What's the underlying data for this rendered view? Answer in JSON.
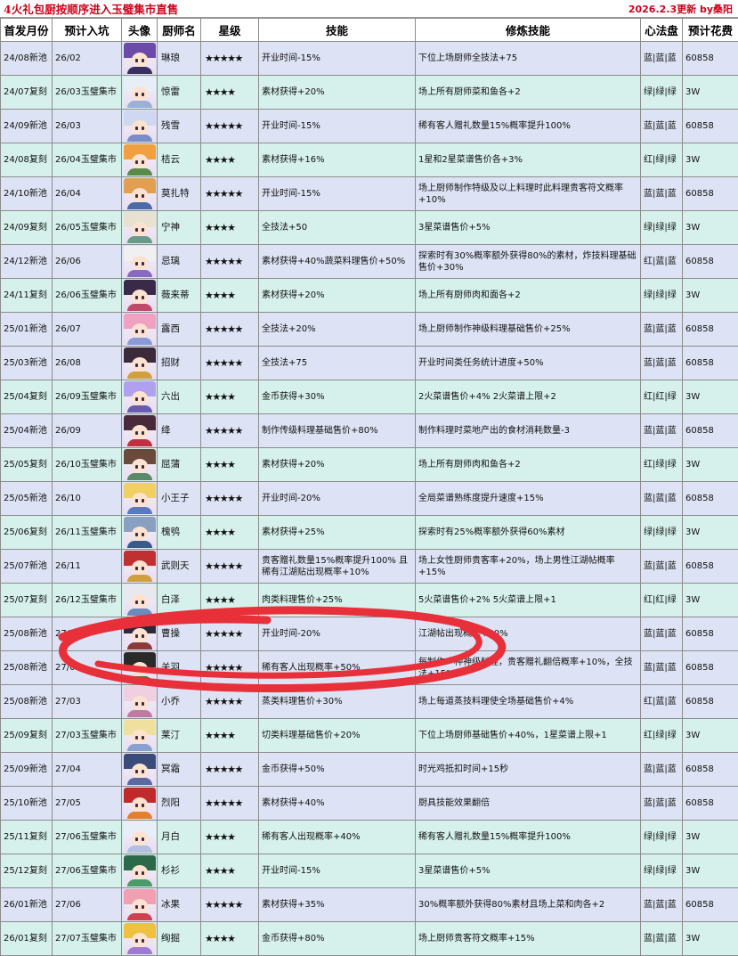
{
  "header": {
    "title": "4火礼包厨按顺序进入玉璧集市直售",
    "update": "2026.2.3更新 by桑阳"
  },
  "columns": [
    "首发月份",
    "预计入坑",
    "头像",
    "厨师名",
    "星级",
    "技能",
    "修炼技能",
    "心法盘",
    "预计花费"
  ],
  "colors": {
    "blue_row": "#dde3f4",
    "green_row": "#d6f1ec",
    "title_red": "#d0021b",
    "annotation_red": "#e8303a"
  },
  "rows": [
    {
      "first": "24/08新池",
      "entry": "26/02",
      "avatar": "avatar-linlang",
      "name": "琳琅",
      "stars": "★★★★★",
      "skill": "开业时间-15%",
      "cultivate": "下位上场厨师全技法+75",
      "heart": "蓝|蓝|蓝",
      "cost": "60858",
      "tint": "blue",
      "hair": "#6b4aa8",
      "cloth": "#3a3060"
    },
    {
      "first": "24/07复刻",
      "entry": "26/03玉璧集市",
      "avatar": "avatar-jinglei",
      "name": "惊雷",
      "stars": "★★★★",
      "skill": "素材获得+20%",
      "cultivate": "场上所有厨师菜和鱼各+2",
      "heart": "绿|绿|绿",
      "cost": "3W",
      "tint": "green",
      "hair": "#e8eef8",
      "cloth": "#9ab0d8"
    },
    {
      "first": "24/09新池",
      "entry": "26/03",
      "avatar": "avatar-canxue",
      "name": "残雪",
      "stars": "★★★★★",
      "skill": "开业时间-15%",
      "cultivate": "稀有客人赠礼数量15%概率提升100%",
      "heart": "蓝|蓝|蓝",
      "cost": "60858",
      "tint": "blue",
      "hair": "#cfd8f0",
      "cloth": "#7b8cc8"
    },
    {
      "first": "24/08复刻",
      "entry": "26/04玉璧集市",
      "avatar": "avatar-jieyun",
      "name": "桔云",
      "stars": "★★★★",
      "skill": "素材获得+16%",
      "cultivate": "1星和2星菜谱售价各+3%",
      "heart": "红|绿|绿",
      "cost": "3W",
      "tint": "green",
      "hair": "#f0a040",
      "cloth": "#5a8a4a"
    },
    {
      "first": "24/10新池",
      "entry": "26/04",
      "avatar": "avatar-mozhate",
      "name": "莫扎特",
      "stars": "★★★★★",
      "skill": "开业时间-15%",
      "cultivate": "场上厨师制作特级及以上料理时此料理贵客符文概率+10%",
      "heart": "蓝|蓝|蓝",
      "cost": "60858",
      "tint": "blue",
      "hair": "#e0a050",
      "cloth": "#4a6aa8"
    },
    {
      "first": "24/09复刻",
      "entry": "26/05玉璧集市",
      "avatar": "avatar-ningshen",
      "name": "宁神",
      "stars": "★★★★",
      "skill": "全技法+50",
      "cultivate": "3星菜谱售价+5%",
      "heart": "绿|绿|绿",
      "cost": "3W",
      "tint": "green",
      "hair": "#e8e0d0",
      "cloth": "#6a9a8a"
    },
    {
      "first": "24/12新池",
      "entry": "26/06",
      "avatar": "avatar-jili",
      "name": "忌璃",
      "stars": "★★★★★",
      "skill": "素材获得+40%蔬菜料理售价+50%",
      "cultivate": "探索时有30%概率额外获得80%的素材，炸技料理基础售价+30%",
      "heart": "红|蓝|蓝",
      "cost": "60858",
      "tint": "blue",
      "hair": "#f0f0f0",
      "cloth": "#8a6ac0"
    },
    {
      "first": "24/11复刻",
      "entry": "26/06玉璧集市",
      "avatar": "avatar-weilaidi",
      "name": "薇来蒂",
      "stars": "★★★★",
      "skill": "素材获得+20%",
      "cultivate": "场上所有厨师肉和面各+2",
      "heart": "绿|绿|绿",
      "cost": "3W",
      "tint": "green",
      "hair": "#3a2a4a",
      "cloth": "#c04a6a"
    },
    {
      "first": "25/01新池",
      "entry": "26/07",
      "avatar": "avatar-luxi",
      "name": "露西",
      "stars": "★★★★★",
      "skill": "全技法+20%",
      "cultivate": "场上厨师制作神级料理基础售价+25%",
      "heart": "蓝|蓝|蓝",
      "cost": "60858",
      "tint": "blue",
      "hair": "#f0a0c0",
      "cloth": "#8a9ad8"
    },
    {
      "first": "25/03新池",
      "entry": "26/08",
      "avatar": "avatar-zhaocai",
      "name": "招财",
      "stars": "★★★★★",
      "skill": "全技法+75",
      "cultivate": "开业时间类任务统计进度+50%",
      "heart": "蓝|蓝|蓝",
      "cost": "60858",
      "tint": "blue",
      "hair": "#3a2a3a",
      "cloth": "#d0a040"
    },
    {
      "first": "25/04复刻",
      "entry": "26/09玉璧集市",
      "avatar": "avatar-liuchu",
      "name": "六出",
      "stars": "★★★★",
      "skill": "金币获得+30%",
      "cultivate": "2火菜谱售价+4% 2火菜谱上限+2",
      "heart": "红|红|绿",
      "cost": "3W",
      "tint": "green",
      "hair": "#b0a0f0",
      "cloth": "#6a5ab0"
    },
    {
      "first": "25/04新池",
      "entry": "26/09",
      "avatar": "avatar-feng",
      "name": "绛",
      "stars": "★★★★★",
      "skill": "制作传级料理基础售价+80%",
      "cultivate": "制作料理时菜地产出的食材消耗数量-3",
      "heart": "蓝|蓝|蓝",
      "cost": "60858",
      "tint": "blue",
      "hair": "#4a2a3a",
      "cloth": "#c03040"
    },
    {
      "first": "25/05复刻",
      "entry": "26/10玉璧集市",
      "avatar": "avatar-qupu",
      "name": "屈蒲",
      "stars": "★★★★",
      "skill": "素材获得+20%",
      "cultivate": "场上所有厨师肉和鱼各+2",
      "heart": "红|绿|绿",
      "cost": "3W",
      "tint": "green",
      "hair": "#6a4a3a",
      "cloth": "#5a8a6a"
    },
    {
      "first": "25/05新池",
      "entry": "26/10",
      "avatar": "avatar-xiaowangzi",
      "name": "小王子",
      "stars": "★★★★★",
      "skill": "开业时间-20%",
      "cultivate": "全局菜谱熟练度提升速度+15%",
      "heart": "蓝|蓝|蓝",
      "cost": "60858",
      "tint": "blue",
      "hair": "#f0d060",
      "cloth": "#5a7ac0"
    },
    {
      "first": "25/06复刻",
      "entry": "26/11玉璧集市",
      "avatar": "avatar-kuige",
      "name": "槐鸮",
      "stars": "★★★★",
      "skill": "素材获得+25%",
      "cultivate": "探索时有25%概率额外获得60%素材",
      "heart": "绿|绿|绿",
      "cost": "3W",
      "tint": "green",
      "hair": "#8aa0c0",
      "cloth": "#3a5a8a"
    },
    {
      "first": "25/07新池",
      "entry": "26/11",
      "avatar": "avatar-wuzetian",
      "name": "武则天",
      "stars": "★★★★★",
      "skill": "贵客赠礼数量15%概率提升100% 且稀有江湖贴出现概率+10%",
      "cultivate": "场上女性厨师贵客率+20%，场上男性江湖帖概率+15%",
      "heart": "蓝|蓝|蓝",
      "cost": "60858",
      "tint": "blue",
      "hair": "#c03030",
      "cloth": "#d0a040"
    },
    {
      "first": "25/07复刻",
      "entry": "26/12玉璧集市",
      "avatar": "avatar-baize",
      "name": "白泽",
      "stars": "★★★★",
      "skill": "肉类料理售价+25%",
      "cultivate": "5火菜谱售价+2% 5火菜谱上限+1",
      "heart": "红|红|绿",
      "cost": "3W",
      "tint": "green",
      "hair": "#e8e8f0",
      "cloth": "#6a8ac0"
    },
    {
      "first": "25/08新池",
      "entry": "27/01",
      "avatar": "avatar-caocao",
      "name": "曹操",
      "stars": "★★★★★",
      "skill": "开业时间-20%",
      "cultivate": "江湖帖出现概率+40%",
      "heart": "蓝|蓝|蓝",
      "cost": "60858",
      "tint": "blue",
      "hair": "#2a2a3a",
      "cloth": "#8a3a3a"
    },
    {
      "first": "25/08新池",
      "entry": "27/02",
      "avatar": "avatar-guanyu",
      "name": "关羽",
      "stars": "★★★★★",
      "skill": "稀有客人出现概率+50%",
      "cultivate": "每制作一种神级料理，贵客赠礼翻倍概率+10%，全技法+15%",
      "heart": "蓝|蓝|蓝",
      "cost": "60858",
      "tint": "blue",
      "hair": "#2a2a2a",
      "cloth": "#3a7a3a"
    },
    {
      "first": "25/08新池",
      "entry": "27/03",
      "avatar": "avatar-xiaoqiao",
      "name": "小乔",
      "stars": "★★★★★",
      "skill": "蒸类料理售价+30%",
      "cultivate": "场上每道蒸技料理使全场基础售价+4%",
      "heart": "红|蓝|蓝",
      "cost": "60858",
      "tint": "blue",
      "hair": "#f0d0e0",
      "cloth": "#c07aa0"
    },
    {
      "first": "25/09复刻",
      "entry": "27/03玉璧集市",
      "avatar": "avatar-moting",
      "name": "莱汀",
      "stars": "★★★★",
      "skill": "切类料理基础售价+20%",
      "cultivate": "下位上场厨师基础售价+40%，1星菜谱上限+1",
      "heart": "红|绿|绿",
      "cost": "3W",
      "tint": "green",
      "hair": "#f0e0a0",
      "cloth": "#8aa0d0"
    },
    {
      "first": "25/09新池",
      "entry": "27/04",
      "avatar": "avatar-mingshuang",
      "name": "冥霜",
      "stars": "★★★★★",
      "skill": "金币获得+50%",
      "cultivate": "时光鸡抵扣时间+15秒",
      "heart": "蓝|蓝|蓝",
      "cost": "60858",
      "tint": "blue",
      "hair": "#3a4a7a",
      "cloth": "#5a6aa0"
    },
    {
      "first": "25/10新池",
      "entry": "27/05",
      "avatar": "avatar-lieyang",
      "name": "烈阳",
      "stars": "★★★★★",
      "skill": "素材获得+40%",
      "cultivate": "厨具技能效果翻倍",
      "heart": "蓝|蓝|蓝",
      "cost": "60858",
      "tint": "blue",
      "hair": "#c02a2a",
      "cloth": "#e08030"
    },
    {
      "first": "25/11复刻",
      "entry": "27/06玉璧集市",
      "avatar": "avatar-yuebai",
      "name": "月白",
      "stars": "★★★★",
      "skill": "稀有客人出现概率+40%",
      "cultivate": "稀有客人赠礼数量15%概率提升100%",
      "heart": "绿|绿|绿",
      "cost": "3W",
      "tint": "green",
      "hair": "#e8eef8",
      "cloth": "#b0c0e0"
    },
    {
      "first": "25/12复刻",
      "entry": "27/06玉璧集市",
      "avatar": "avatar-shanshan",
      "name": "杉衫",
      "stars": "★★★★",
      "skill": "开业时间-15%",
      "cultivate": "3星菜谱售价+5%",
      "heart": "绿|绿|绿",
      "cost": "3W",
      "tint": "green",
      "hair": "#2a6a4a",
      "cloth": "#4a9a6a"
    },
    {
      "first": "26/01新池",
      "entry": "27/06",
      "avatar": "avatar-bingguo",
      "name": "冰果",
      "stars": "★★★★★",
      "skill": "素材获得+35%",
      "cultivate": "30%概率额外获得80%素材且场上菜和肉各+2",
      "heart": "蓝|蓝|蓝",
      "cost": "60858",
      "tint": "blue",
      "hair": "#f0a0b0",
      "cloth": "#d04050"
    },
    {
      "first": "26/01复刻",
      "entry": "27/07玉璧集市",
      "avatar": "avatar-xuanjue",
      "name": "绚掘",
      "stars": "★★★★",
      "skill": "金币获得+80%",
      "cultivate": "场上厨师贵客符文概率+15%",
      "heart": "蓝|蓝|蓝",
      "cost": "3W",
      "tint": "green",
      "hair": "#f0c040",
      "cloth": "#a07ad0"
    }
  ]
}
